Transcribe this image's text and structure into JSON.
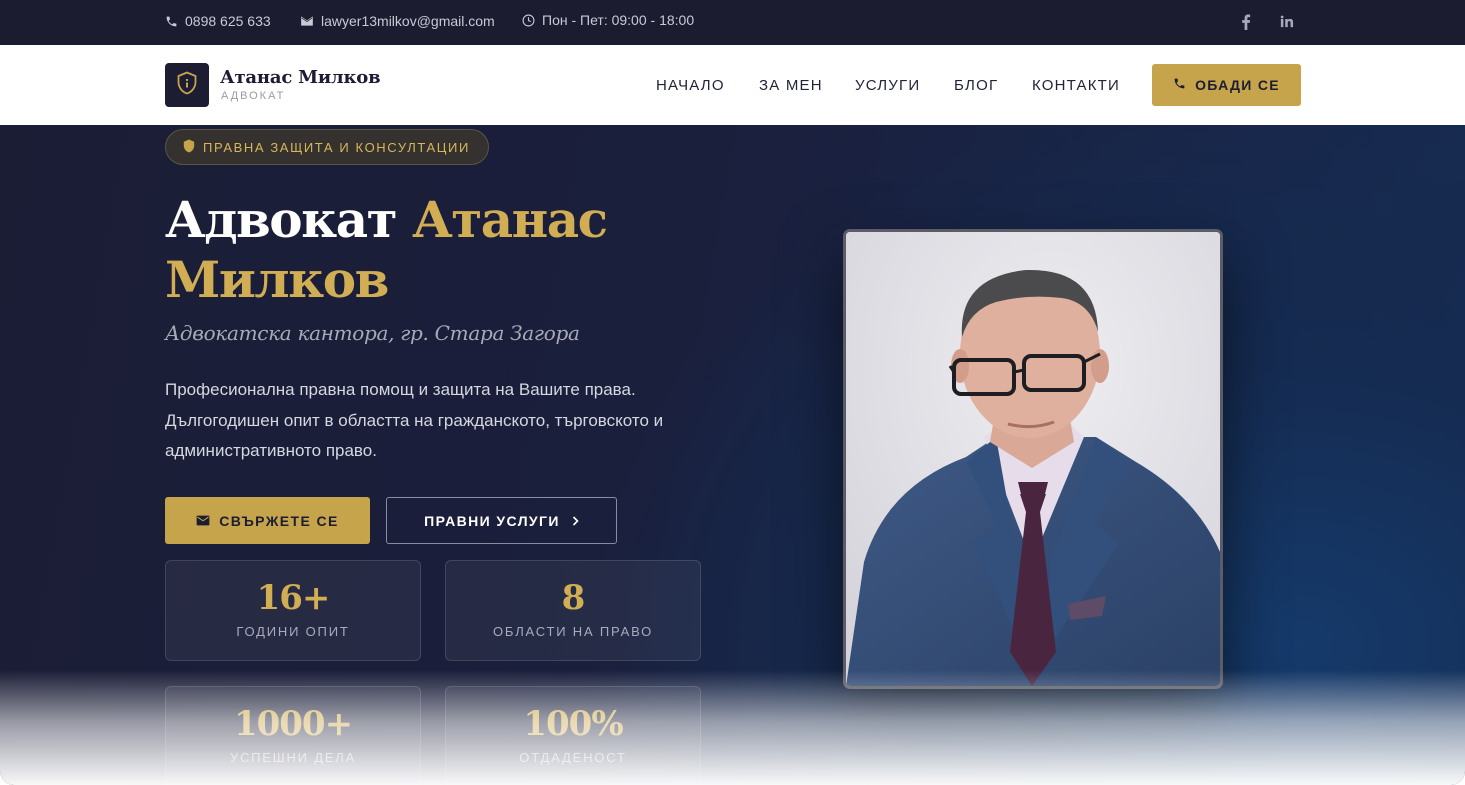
{
  "topbar": {
    "phone": "0898 625 633",
    "email": "lawyer13milkov@gmail.com",
    "hours": "Пон - Пет: 09:00 - 18:00",
    "icons": [
      "phone-icon",
      "mail-icon",
      "clock-icon",
      "facebook-icon",
      "linkedin-icon"
    ]
  },
  "header": {
    "brand_name": "Атанас Милков",
    "brand_sub": "АДВОКАТ",
    "nav": [
      "НАЧАЛО",
      "ЗА МЕН",
      "УСЛУГИ",
      "БЛОГ",
      "КОНТАКТИ"
    ],
    "call_label": "ОБАДИ СЕ"
  },
  "hero": {
    "badge": "ПРАВНА ЗАЩИТА И КОНСУЛТАЦИИ",
    "title_white": "Адвокат",
    "title_gold": "Атанас Милков",
    "subtitle": "Адвокатска кантора, гр. Стара Загора",
    "description": "Професионална правна помощ и защита на Вашите права. Дългогодишен опит в областта на гражданското, търговското и административното право.",
    "btn_contact": "СВЪРЖЕТЕ СЕ",
    "btn_services": "ПРАВНИ УСЛУГИ",
    "stats": [
      {
        "value": "16+",
        "label": "ГОДИНИ ОПИТ"
      },
      {
        "value": "8",
        "label": "ОБЛАСТИ НА ПРАВО"
      },
      {
        "value": "1000+",
        "label": "УСПЕШНИ ДЕЛА"
      },
      {
        "value": "100%",
        "label": "ОТДАДЕНОСТ"
      }
    ]
  },
  "colors": {
    "navy": "#1b1c30",
    "gold": "#c6a44b",
    "gold_text": "#d1ad54",
    "white": "#ffffff"
  }
}
